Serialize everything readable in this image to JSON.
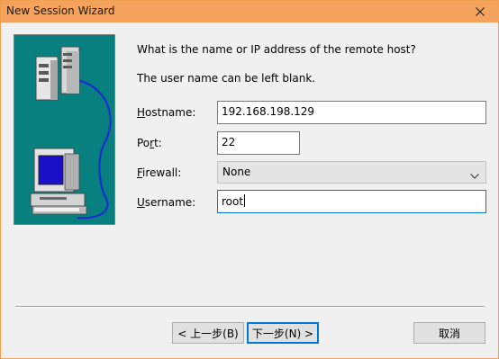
{
  "window": {
    "title": "New Session Wizard",
    "close_icon": "close-icon",
    "accent_color": "#f5a35c"
  },
  "prompt": {
    "line1": "What is the name or IP address of the remote host?",
    "line2": "The user name can be left blank."
  },
  "form": {
    "hostname": {
      "label_accel": "H",
      "label_rest": "ostname:",
      "value": "192.168.198.129"
    },
    "port": {
      "label_pre": "Po",
      "label_accel": "r",
      "label_rest": "t:",
      "value": "22"
    },
    "firewall": {
      "label_accel": "F",
      "label_rest": "irewall:",
      "value": "None"
    },
    "username": {
      "label_accel": "U",
      "label_rest": "sername:",
      "value": "root"
    }
  },
  "buttons": {
    "back_label": "< 上一步(B)",
    "next_label": "下一步(N) >",
    "cancel_label": "取消"
  },
  "art": {
    "icons": [
      "server-icon",
      "computer-icon"
    ],
    "background_color": "#08807f"
  }
}
